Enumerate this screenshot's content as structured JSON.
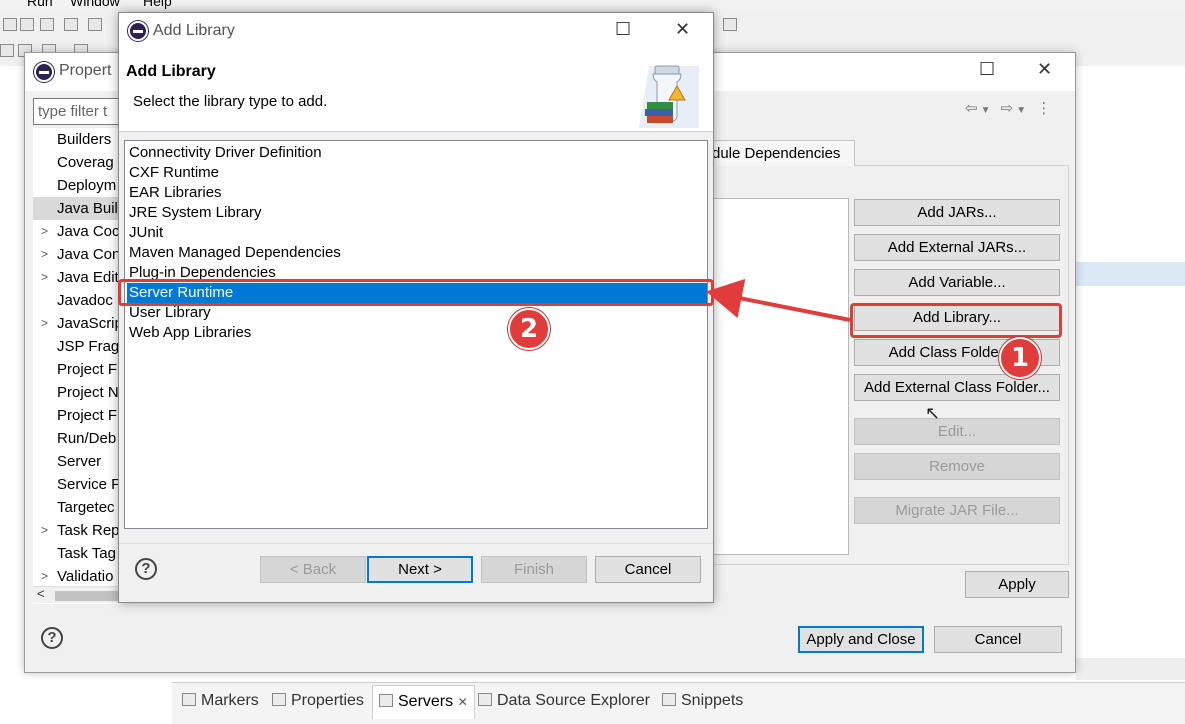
{
  "menubar": {
    "items": [
      "Run",
      "Window",
      "Help"
    ]
  },
  "properties_dialog": {
    "title": "Propert",
    "filter_placeholder": "type filter t",
    "tree_items": [
      {
        "label": "Builders",
        "expandable": false
      },
      {
        "label": "Coverag",
        "expandable": false
      },
      {
        "label": "Deploym",
        "expandable": false
      },
      {
        "label": "Java Buil",
        "expandable": false,
        "selected": true
      },
      {
        "label": "Java Coc",
        "expandable": true
      },
      {
        "label": "Java Con",
        "expandable": true
      },
      {
        "label": "Java Edit",
        "expandable": true
      },
      {
        "label": "Javadoc",
        "expandable": false
      },
      {
        "label": "JavaScrip",
        "expandable": true
      },
      {
        "label": "JSP Frag",
        "expandable": false
      },
      {
        "label": "Project F",
        "expandable": false
      },
      {
        "label": "Project N",
        "expandable": false
      },
      {
        "label": "Project F",
        "expandable": false
      },
      {
        "label": "Run/Deb",
        "expandable": false
      },
      {
        "label": "Server",
        "expandable": false
      },
      {
        "label": "Service F",
        "expandable": false
      },
      {
        "label": "Targetec",
        "expandable": false
      },
      {
        "label": "Task Rep",
        "expandable": true
      },
      {
        "label": "Task Tag",
        "expandable": false
      },
      {
        "label": "Validatio",
        "expandable": true
      }
    ],
    "tab_label": "dule Dependencies",
    "buttons": {
      "add_jars": "Add JARs...",
      "add_external_jars": "Add External JARs...",
      "add_variable": "Add Variable...",
      "add_library": "Add Library...",
      "add_class_folder": "Add Class Folder...",
      "add_external_class_folder": "Add External Class Folder...",
      "edit": "Edit...",
      "remove": "Remove",
      "migrate_jar": "Migrate JAR File...",
      "apply": "Apply",
      "apply_and_close": "Apply and Close",
      "cancel": "Cancel"
    }
  },
  "add_library_dialog": {
    "title": "Add Library",
    "heading": "Add Library",
    "description": "Select the library type to add.",
    "library_types": [
      "Connectivity Driver Definition",
      "CXF Runtime",
      "EAR Libraries",
      "JRE System Library",
      "JUnit",
      "Maven Managed Dependencies",
      "Plug-in Dependencies",
      "Server Runtime",
      "User Library",
      "Web App Libraries"
    ],
    "selected_index": 7,
    "buttons": {
      "back": "< Back",
      "next": "Next >",
      "finish": "Finish",
      "cancel": "Cancel"
    }
  },
  "bottom_tabs": [
    {
      "label": "Markers",
      "icon": "markers-icon"
    },
    {
      "label": "Properties",
      "icon": "properties-icon"
    },
    {
      "label": "Servers",
      "icon": "servers-icon",
      "active": true
    },
    {
      "label": "Data Source Explorer",
      "icon": "data-source-icon"
    },
    {
      "label": "Snippets",
      "icon": "snippets-icon"
    }
  ],
  "annotations": [
    {
      "number": "1",
      "target": "Add Library..."
    },
    {
      "number": "2",
      "target": "Server Runtime"
    }
  ],
  "colors": {
    "selection": "#0078d7",
    "annotation_red": "#e03c3c",
    "dialog_bg": "#f0f0f0"
  }
}
